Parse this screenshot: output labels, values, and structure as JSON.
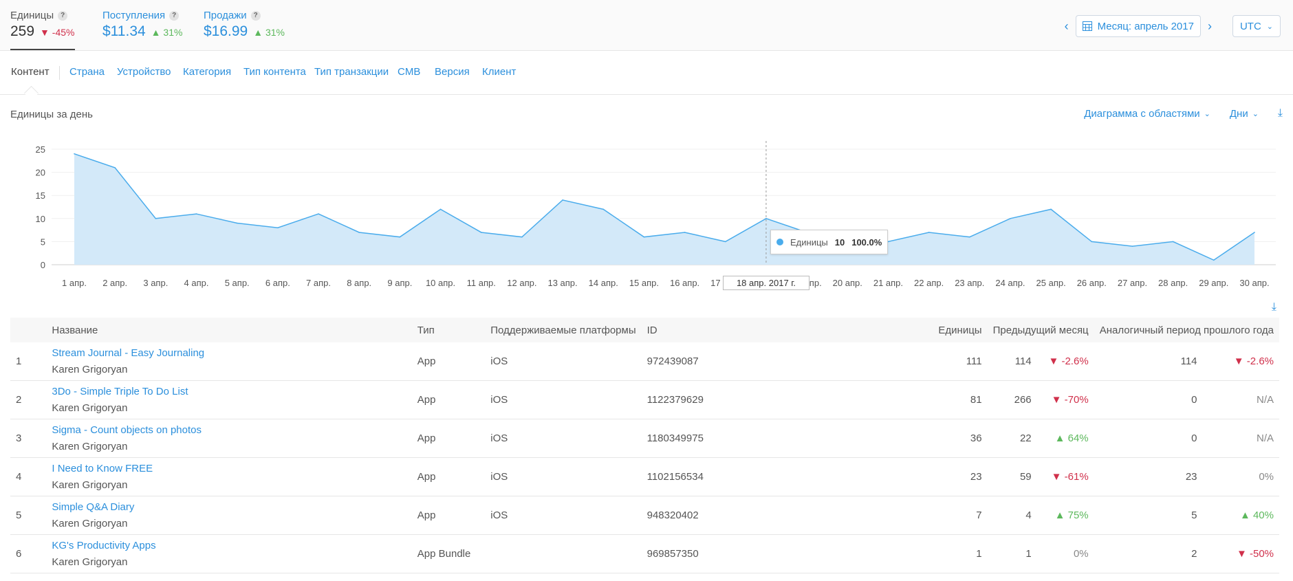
{
  "metrics": [
    {
      "label": "Единицы",
      "value": "259",
      "change": "-45%",
      "dir": "down"
    },
    {
      "label": "Поступления",
      "value": "$11.34",
      "change": "31%",
      "dir": "up"
    },
    {
      "label": "Продажи",
      "value": "$16.99",
      "change": "31%",
      "dir": "up"
    }
  ],
  "period": {
    "label": "Месяц: апрель 2017",
    "timezone": "UTC"
  },
  "tabs": [
    "Контент",
    "Страна",
    "Устройство",
    "Категория",
    "Тип контента",
    "Тип транзакции",
    "CMB",
    "Версия",
    "Клиент"
  ],
  "chart_header": {
    "title": "Единицы за день",
    "chart_type_label": "Диаграмма с областями",
    "interval_label": "Дни"
  },
  "chart_data": {
    "type": "area",
    "title": "Единицы за день",
    "x": [
      "1 апр.",
      "2 апр.",
      "3 апр.",
      "4 апр.",
      "5 апр.",
      "6 апр.",
      "7 апр.",
      "8 апр.",
      "9 апр.",
      "10 апр.",
      "11 апр.",
      "12 апр.",
      "13 апр.",
      "14 апр.",
      "15 апр.",
      "16 апр.",
      "17 апр.",
      "18 апр.",
      "19 апр.",
      "20 апр.",
      "21 апр.",
      "22 апр.",
      "23 апр.",
      "24 апр.",
      "25 апр.",
      "26 апр.",
      "27 апр.",
      "28 апр.",
      "29 апр.",
      "30 апр."
    ],
    "series": [
      {
        "name": "Единицы",
        "values": [
          24,
          21,
          10,
          11,
          9,
          8,
          11,
          7,
          6,
          12,
          7,
          6,
          14,
          12,
          6,
          7,
          5,
          10,
          7,
          6,
          5,
          7,
          6,
          10,
          12,
          5,
          4,
          5,
          1,
          7
        ]
      }
    ],
    "yticks": [
      0,
      5,
      10,
      15,
      20,
      25
    ],
    "ylim": [
      0,
      25
    ],
    "grid": true,
    "color": "#4aacec",
    "fill": "#d3e9f9"
  },
  "tooltip": {
    "series": "Единицы",
    "value": "10",
    "percent": "100.0%",
    "date": "18 апр. 2017 г."
  },
  "table": {
    "headers": {
      "name": "Название",
      "type": "Тип",
      "platforms": "Поддерживаемые платформы",
      "id": "ID",
      "units": "Единицы",
      "prev_month": "Предыдущий месяц",
      "prev_year": "Аналогичный период прошлого года"
    },
    "rows": [
      {
        "rank": "1",
        "name": "Stream Journal - Easy Journaling",
        "developer": "Karen Grigoryan",
        "type": "App",
        "platform": "iOS",
        "id": "972439087",
        "units": "111",
        "prev_month": "114",
        "prev_month_change": "-2.6%",
        "pm_dir": "down",
        "prev_year": "114",
        "prev_year_change": "-2.6%",
        "py_dir": "down"
      },
      {
        "rank": "2",
        "name": "3Do - Simple Triple To Do List",
        "developer": "Karen Grigoryan",
        "type": "App",
        "platform": "iOS",
        "id": "1122379629",
        "units": "81",
        "prev_month": "266",
        "prev_month_change": "-70%",
        "pm_dir": "down",
        "prev_year": "0",
        "prev_year_change": "N/A",
        "py_dir": "neutral"
      },
      {
        "rank": "3",
        "name": "Sigma - Count objects on photos",
        "developer": "Karen Grigoryan",
        "type": "App",
        "platform": "iOS",
        "id": "1180349975",
        "units": "36",
        "prev_month": "22",
        "prev_month_change": "64%",
        "pm_dir": "up",
        "prev_year": "0",
        "prev_year_change": "N/A",
        "py_dir": "neutral"
      },
      {
        "rank": "4",
        "name": "I Need to Know FREE",
        "developer": "Karen Grigoryan",
        "type": "App",
        "platform": "iOS",
        "id": "1102156534",
        "units": "23",
        "prev_month": "59",
        "prev_month_change": "-61%",
        "pm_dir": "down",
        "prev_year": "23",
        "prev_year_change": "0%",
        "py_dir": "neutral"
      },
      {
        "rank": "5",
        "name": "Simple Q&A Diary",
        "developer": "Karen Grigoryan",
        "type": "App",
        "platform": "iOS",
        "id": "948320402",
        "units": "7",
        "prev_month": "4",
        "prev_month_change": "75%",
        "pm_dir": "up",
        "prev_year": "5",
        "prev_year_change": "40%",
        "py_dir": "up"
      },
      {
        "rank": "6",
        "name": "KG's Productivity Apps",
        "developer": "Karen Grigoryan",
        "type": "App Bundle",
        "platform": "",
        "id": "969857350",
        "units": "1",
        "prev_month": "1",
        "prev_month_change": "0%",
        "pm_dir": "neutral",
        "prev_year": "2",
        "prev_year_change": "-50%",
        "py_dir": "down"
      }
    ]
  },
  "icons": {
    "calendar": "calendar-icon",
    "chevron_left": "chevron-left-icon",
    "chevron_right": "chevron-right-icon",
    "download": "download-icon",
    "help": "help-icon"
  }
}
